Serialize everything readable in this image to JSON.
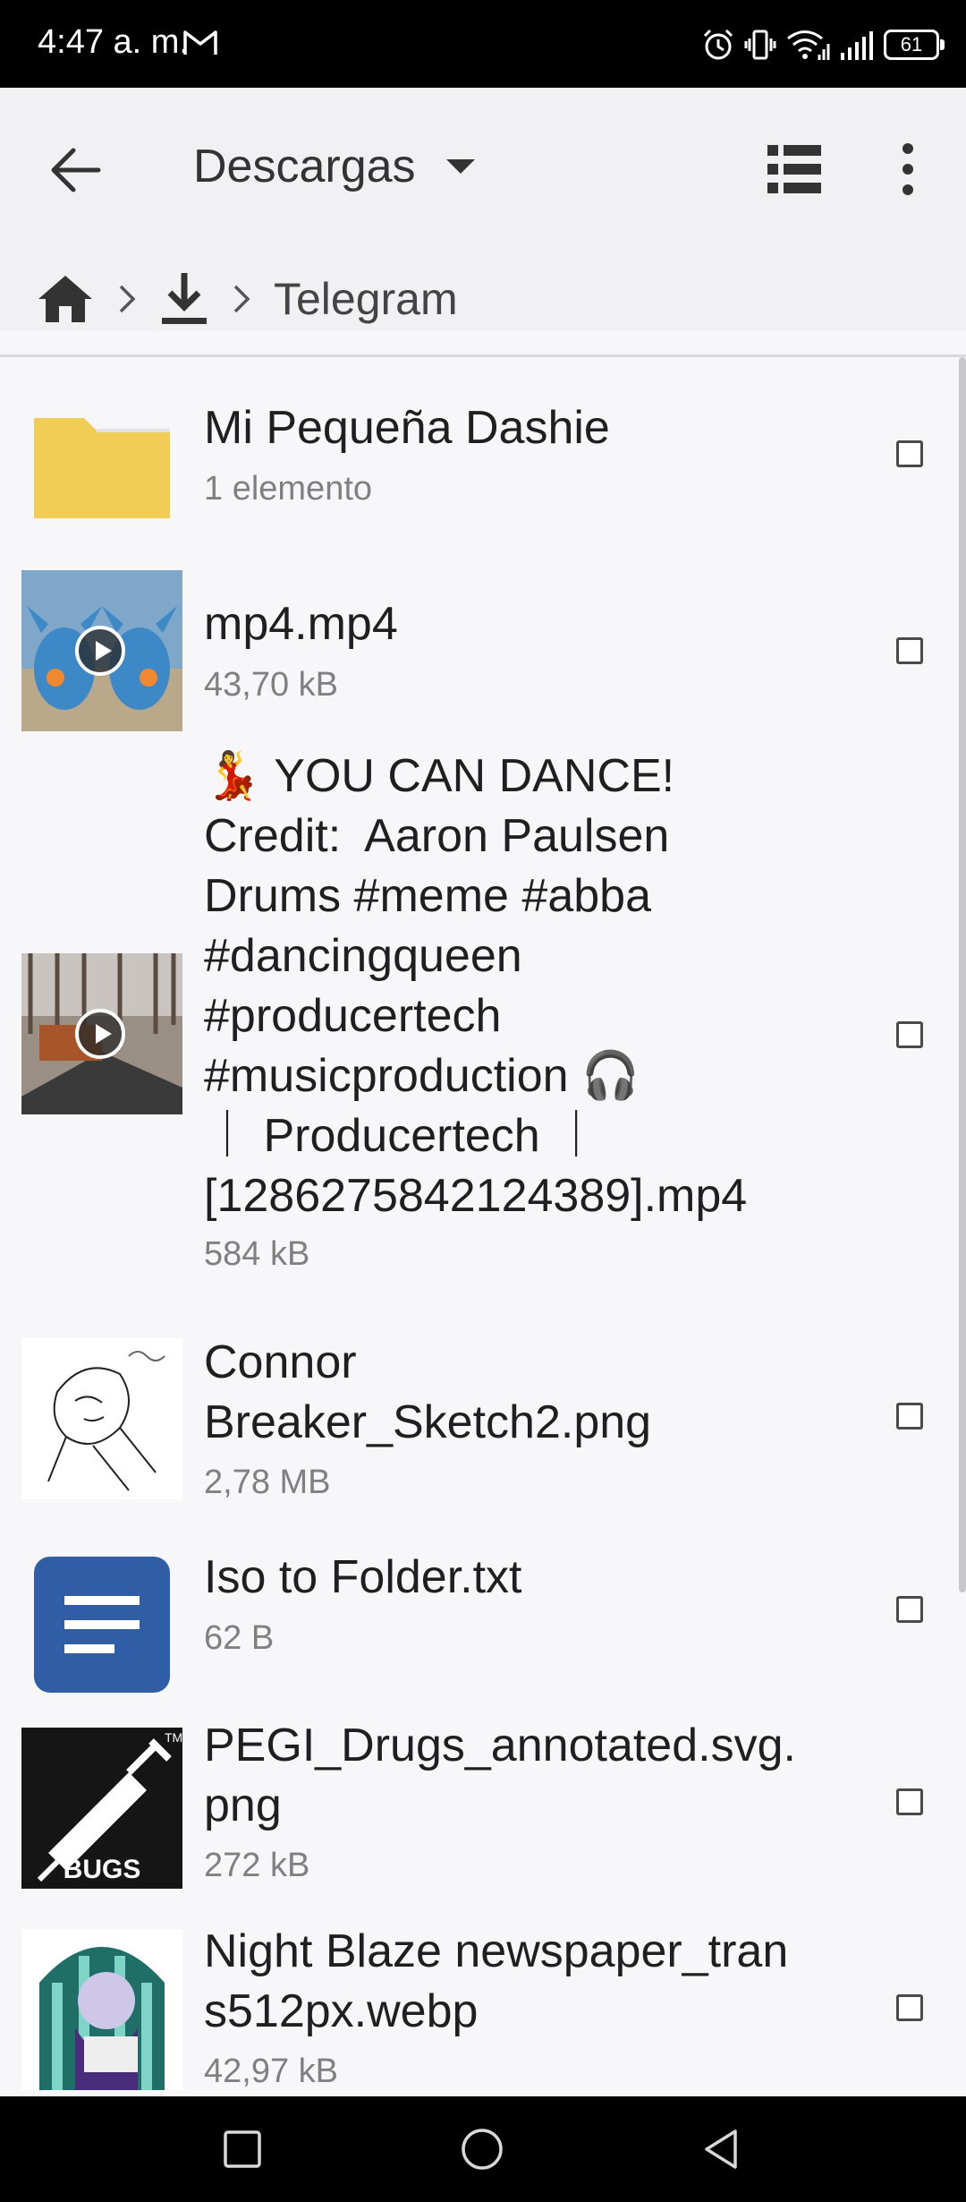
{
  "status_bar": {
    "time": "4:47 a. m.",
    "battery": "61"
  },
  "toolbar": {
    "title": "Descargas"
  },
  "breadcrumb": {
    "current": "Telegram"
  },
  "files": [
    {
      "name": "Mi Pequeña Dashie",
      "meta": "1 elemento",
      "icon": "folder-icon"
    },
    {
      "name": "mp4.mp4",
      "meta": "43,70 kB",
      "icon": "video-thumbnail"
    },
    {
      "name": "💃 YOU CAN DANCE!\nCredit:  Aaron Paulsen\nDrums #meme #abba\n#dancingqueen\n#producertech\n#musicproduction 🎧\n｜ Producertech ｜\n[1286275842124389].mp4",
      "meta": "584 kB",
      "icon": "video-thumbnail"
    },
    {
      "name": "Connor\nBreaker_Sketch2.png",
      "meta": "2,78 MB",
      "icon": "image-thumbnail"
    },
    {
      "name": "Iso to Folder.txt",
      "meta": "62 B",
      "icon": "text-file-icon"
    },
    {
      "name": "PEGI_Drugs_annotated.svg.\npng",
      "meta": "272 kB",
      "icon": "image-thumbnail",
      "badge": "BUGS"
    },
    {
      "name": "Night Blaze newspaper_tran\ns512px.webp",
      "meta": "42,97 kB",
      "icon": "image-thumbnail"
    }
  ],
  "colors": {
    "folder": "#f1cd55",
    "text_icon": "#2f5ea6",
    "background": "#f7f7f9"
  }
}
